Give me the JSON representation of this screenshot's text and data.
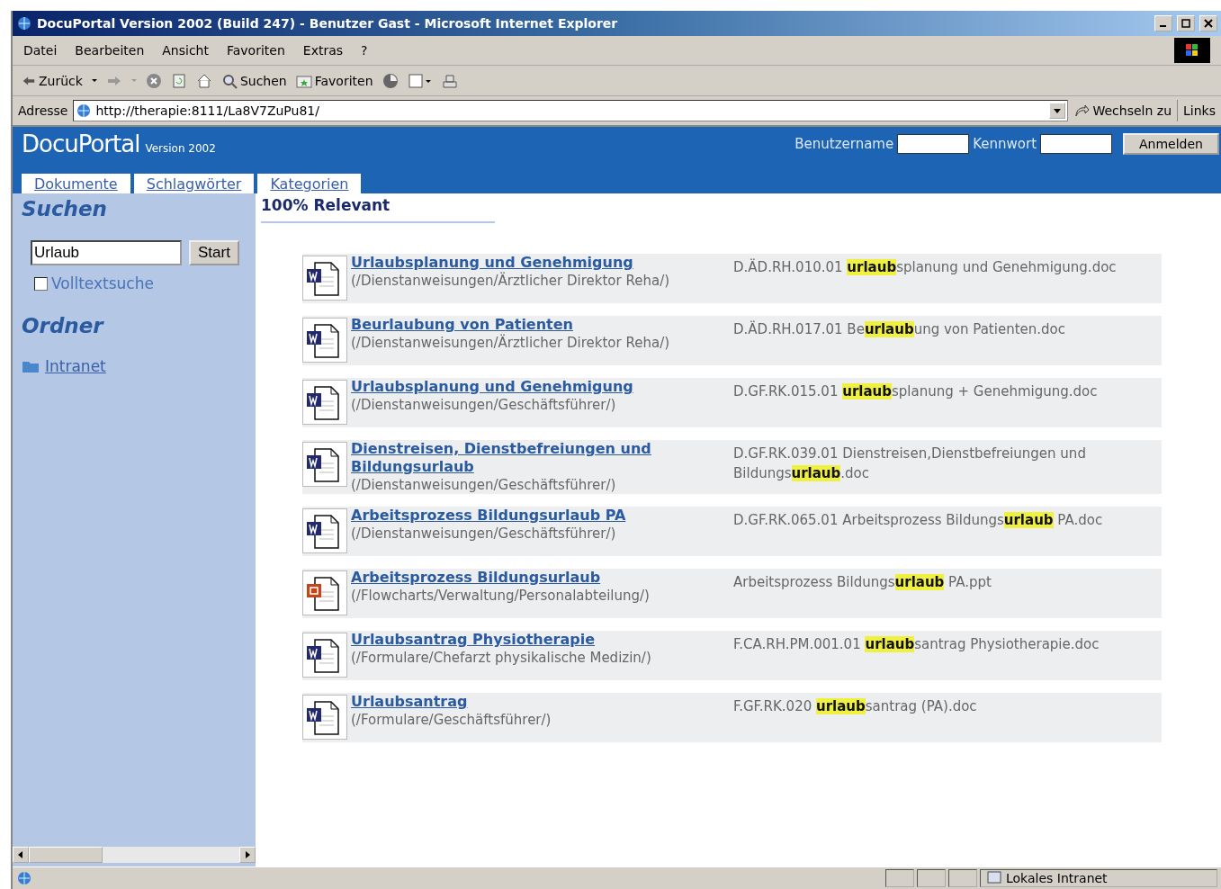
{
  "window": {
    "title": "DocuPortal Version 2002 (Build 247) - Benutzer Gast - Microsoft Internet Explorer"
  },
  "menu": [
    "Datei",
    "Bearbeiten",
    "Ansicht",
    "Favoriten",
    "Extras",
    "?"
  ],
  "toolbar": {
    "back": "Zurück",
    "search": "Suchen",
    "favorites": "Favoriten"
  },
  "address": {
    "label": "Adresse",
    "value": "http://therapie:8111/La8V7ZuPu81/",
    "go": "Wechseln zu",
    "links": "Links"
  },
  "header": {
    "brand": "DocuPortal",
    "version": "Version 2002",
    "username_label": "Benutzername",
    "password_label": "Kennwort",
    "login": "Anmelden"
  },
  "tabs": [
    "Dokumente",
    "Schlagwörter",
    "Kategorien"
  ],
  "sidebar": {
    "search_title": "Suchen",
    "search_value": "Urlaub",
    "start": "Start",
    "fulltext": {
      "label": "Volltextsuche",
      "checked": false
    },
    "folders_title": "Ordner",
    "folders": [
      "Intranet"
    ]
  },
  "results": {
    "heading": "100% Relevant",
    "items": [
      {
        "kind": "word",
        "title": "Urlaubsplanung und Genehmigung",
        "path": "(/Dienstanweisungen/Ärztlicher Direktor Reha/)",
        "file": "D.ÄD.RH.010.01 **urlaub**splanung und Genehmigung.doc"
      },
      {
        "kind": "word",
        "title": "Beurlaubung von Patienten",
        "path": "(/Dienstanweisungen/Ärztlicher Direktor Reha/)",
        "file": "D.ÄD.RH.017.01 Be**urlaub**ung von Patienten.doc"
      },
      {
        "kind": "word",
        "title": "Urlaubsplanung und Genehmigung",
        "path": "(/Dienstanweisungen/Geschäftsführer/)",
        "file": "D.GF.RK.015.01 **urlaub**splanung + Genehmigung.doc"
      },
      {
        "kind": "word",
        "title": "Dienstreisen, Dienstbefreiungen und Bildungsurlaub",
        "path": "(/Dienstanweisungen/Geschäftsführer/)",
        "file": "D.GF.RK.039.01 Dienstreisen,Dienstbefreiungen und Bildungs**urlaub**.doc"
      },
      {
        "kind": "word",
        "title": "Arbeitsprozess Bildungsurlaub PA",
        "path": "(/Dienstanweisungen/Geschäftsführer/)",
        "file": "D.GF.RK.065.01 Arbeitsprozess Bildungs**urlaub** PA.doc"
      },
      {
        "kind": "powerpoint",
        "title": "Arbeitsprozess Bildungsurlaub",
        "path": "(/Flowcharts/Verwaltung/Personalabteilung/)",
        "file": "Arbeitsprozess Bildungs**urlaub** PA.ppt"
      },
      {
        "kind": "word",
        "title": "Urlaubsantrag Physiotherapie",
        "path": "(/Formulare/Chefarzt physikalische Medizin/)",
        "file": "F.CA.RH.PM.001.01 **urlaub**santrag Physiotherapie.doc"
      },
      {
        "kind": "word",
        "title": "Urlaubsantrag",
        "path": "(/Formulare/Geschäftsführer/)",
        "file": "F.GF.RK.020 **urlaub**santrag (PA).doc"
      }
    ]
  },
  "status_bar": {
    "zone": "Lokales Intranet"
  }
}
